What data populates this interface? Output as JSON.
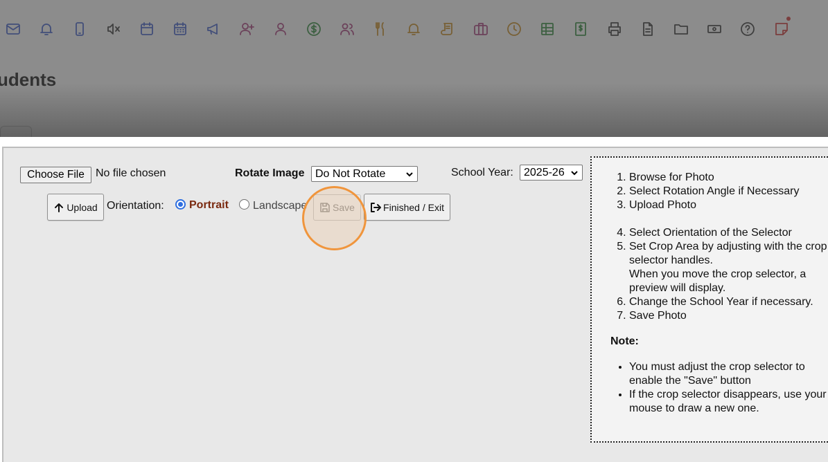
{
  "background": {
    "heading": "udents",
    "toolbar_icons": [
      {
        "name": "mail-icon",
        "color": "#3b5bcc"
      },
      {
        "name": "bell-icon",
        "color": "#3b5bcc"
      },
      {
        "name": "mobile-phone-icon",
        "color": "#3b5bcc"
      },
      {
        "name": "speaker-mute-icon",
        "color": "#333333"
      },
      {
        "name": "calendar-icon",
        "color": "#3b5bcc"
      },
      {
        "name": "calendar-grid-icon",
        "color": "#3b5bcc"
      },
      {
        "name": "megaphone-icon",
        "color": "#3b5bcc"
      },
      {
        "name": "user-add-icon",
        "color": "#a83a7a"
      },
      {
        "name": "user-icon",
        "color": "#a83a7a"
      },
      {
        "name": "dollar-circle-icon",
        "color": "#2e8a3a"
      },
      {
        "name": "users-icon",
        "color": "#a83a7a"
      },
      {
        "name": "fork-knife-icon",
        "color": "#c8891a"
      },
      {
        "name": "bell-alert-icon",
        "color": "#c8891a"
      },
      {
        "name": "scroll-icon",
        "color": "#c8891a"
      },
      {
        "name": "briefcase-icon",
        "color": "#a83a7a"
      },
      {
        "name": "clock-icon",
        "color": "#c8891a"
      },
      {
        "name": "table-icon",
        "color": "#2e8a3a"
      },
      {
        "name": "dollar-document-icon",
        "color": "#2e8a3a"
      },
      {
        "name": "printer-icon",
        "color": "#333333"
      },
      {
        "name": "document-icon",
        "color": "#333333"
      },
      {
        "name": "folder-icon",
        "color": "#333333"
      },
      {
        "name": "money-icon",
        "color": "#333333"
      },
      {
        "name": "help-icon",
        "color": "#333333"
      },
      {
        "name": "sticky-note-icon",
        "color": "#d03030"
      }
    ]
  },
  "upload": {
    "choose_file_label": "Choose File",
    "no_file_text": "No file chosen",
    "rotate_label": "Rotate Image",
    "rotate_value": "Do Not Rotate",
    "school_year_label": "School Year:",
    "school_year_value": "2025-26",
    "upload_button": "Upload",
    "orientation_label": "Orientation:",
    "portrait_label": "Portrait",
    "landscape_label": "Landscape",
    "orientation_selected": "Portrait",
    "save_button": "Save",
    "finished_button": "Finished / Exit"
  },
  "instructions": {
    "steps_a": [
      "Browse for Photo",
      "Select Rotation Angle if Necessary",
      "Upload Photo"
    ],
    "step_4": "Select Orientation of the Selector",
    "step_5_line1": "Set Crop Area by adjusting with the crop selector handles.",
    "step_5_line2": "When you move the crop selector, a preview will display.",
    "step_6": "Change the School Year if necessary.",
    "step_7": "Save Photo",
    "note_title": "Note:",
    "notes": [
      "You must adjust the crop selector to enable the \"Save\" button",
      "If the crop selector disappears, use your mouse to draw a new one."
    ]
  },
  "colors": {
    "highlight": "#f0953c",
    "portrait_text": "#7a2a10",
    "radio_accent": "#2f6fe0"
  }
}
